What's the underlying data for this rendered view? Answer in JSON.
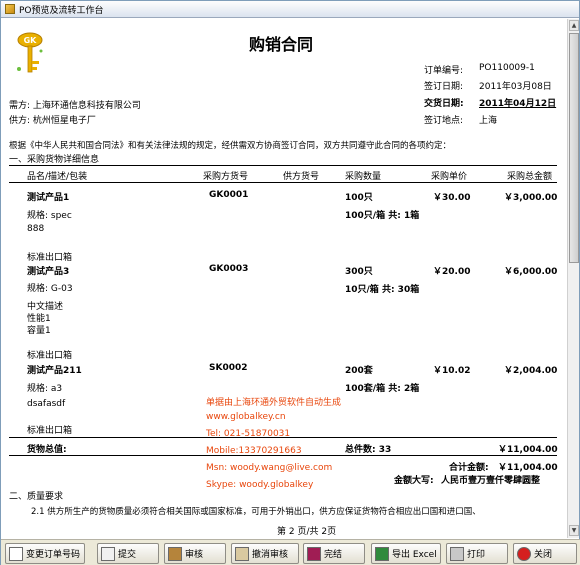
{
  "window": {
    "title": "PO预览及流转工作台"
  },
  "contract": {
    "title": "购销合同",
    "order_no_label": "订单编号:",
    "order_no": "PO110009-1",
    "sign_date_label": "签订日期:",
    "sign_date": "2011年03月08日",
    "delivery_date_label": "交货日期:",
    "delivery_date": "2011年04月12日",
    "sign_place_label": "签订地点:",
    "sign_place": "上海",
    "buyer": "需方: 上海环通信息科技有限公司",
    "supplier": "供方: 杭州恒星电子厂",
    "clause_intro": "根据《中华人民共和国合同法》和有关法律法规的规定，经供需双方协商签订合同，双方共同遵守此合同的各项约定：",
    "section1": "一、采购货物详细信息",
    "section2": "二、质量要求",
    "clause_2_1": "2.1    供方所生产的货物质量必须符合相关国际或国家标准，可用于外销出口，供方应保证货物符合相应出口国和进口国、",
    "page_indicator": "第 2 页/共 2页"
  },
  "table": {
    "headers": [
      "品名/描述/包装",
      "采购方货号",
      "供方货号",
      "采购数量",
      "采购单价",
      "采购总金额"
    ],
    "rows": [
      {
        "name": "测试产品1",
        "spec": "规格: spec",
        "extra": "888",
        "pack": "标准出口箱",
        "buyer_no": "GK0001",
        "supplier_no": "",
        "qty": "100只",
        "qty_box": "100只/箱 共: 1箱",
        "price": "￥30.00",
        "total": "￥3,000.00"
      },
      {
        "name": "测试产品3",
        "spec": "规格: G-03",
        "extra": "中文描述",
        "extra2": "性能1",
        "extra3": "容量1",
        "pack": "标准出口箱",
        "buyer_no": "GK0003",
        "supplier_no": "",
        "qty": "300只",
        "qty_box": "10只/箱 共: 30箱",
        "price": "￥20.00",
        "total": "￥6,000.00"
      },
      {
        "name": "测试产品211",
        "spec": "规格: a3",
        "extra": "dsafasdf",
        "pack": "标准出口箱",
        "buyer_no": "SK0002",
        "supplier_no": "",
        "qty": "200套",
        "qty_box": "100套/箱 共: 2箱",
        "price": "￥10.02",
        "total": "￥2,004.00"
      }
    ],
    "total_label": "货物总值:",
    "total_qty": "总件数: 33",
    "total_amount": "￥11,004.00",
    "sum_label": "合计金额:",
    "sum_value": "￥11,004.00",
    "caps_label": "金额大写:",
    "caps_value": "人民币壹万壹仟零肆圆整"
  },
  "watermark": {
    "line1": "单据由上海环通外贸软件自动生成",
    "line2": "www.globalkey.cn",
    "line3": "Tel: 021-51870031",
    "line4": "Mobile:13370291663",
    "line5": "Msn: woody.wang@live.com",
    "line6": "Skype: woody.globalkey"
  },
  "toolbar": {
    "change_no": "变更订单号码",
    "submit": "提交",
    "approve": "审核",
    "cancel_approve": "撤消审核",
    "finish": "完结",
    "export_excel": "导出 Excel",
    "print": "打印",
    "close": "关闭"
  }
}
